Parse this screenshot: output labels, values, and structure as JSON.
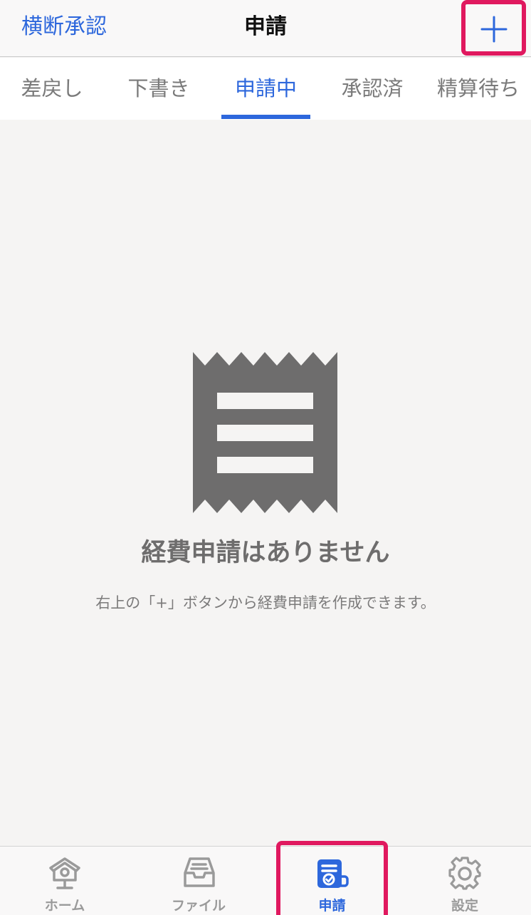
{
  "header": {
    "left_link": "横断承認",
    "title": "申請",
    "add_icon": "plus-icon"
  },
  "tabs": [
    {
      "label": "差戻し"
    },
    {
      "label": "下書き"
    },
    {
      "label": "申請中",
      "active": true
    },
    {
      "label": "承認済"
    },
    {
      "label": "精算待ち"
    }
  ],
  "empty_state": {
    "icon": "receipt-icon",
    "title": "経費申請はありません",
    "description": "右上の「+」ボタンから経費申請を作成できます。"
  },
  "bottom_nav": [
    {
      "label": "ホーム",
      "icon": "home-icon"
    },
    {
      "label": "ファイル",
      "icon": "inbox-tray-icon"
    },
    {
      "label": "申請",
      "icon": "application-document-icon",
      "active": true
    },
    {
      "label": "設定",
      "icon": "gear-icon"
    }
  ],
  "colors": {
    "accent": "#2d67dc",
    "highlight": "#e0195f",
    "icon_gray": "#6e6d6d",
    "inactive_gray": "#9a9a9a",
    "background": "#f5f4f3"
  }
}
